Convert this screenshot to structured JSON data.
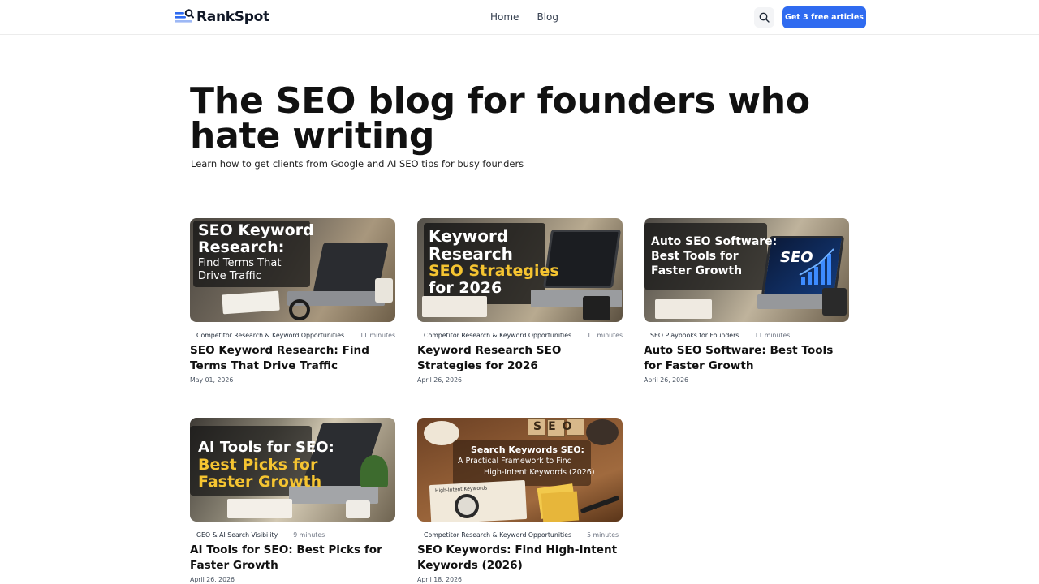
{
  "header": {
    "brand": "RankSpot",
    "nav": [
      "Home",
      "Blog"
    ],
    "cta_label": "Get 3 free articles"
  },
  "hero": {
    "title": "The SEO blog for founders who hate writing",
    "subtitle": "Learn how to get clients from Google and AI SEO tips for busy founders"
  },
  "posts": [
    {
      "category": "Competitor Research & Keyword Opportunities",
      "read_time": "11 minutes",
      "title": "SEO Keyword Research: Find Terms That Drive Traffic",
      "date": "May 01, 2026",
      "image_text": [
        "SEO Keyword",
        "Research:",
        "Find Terms That",
        "Drive Traffic"
      ]
    },
    {
      "category": "Competitor Research & Keyword Opportunities",
      "read_time": "11 minutes",
      "title": "Keyword Research SEO Strategies for 2026",
      "date": "April 26, 2026",
      "image_text": [
        "Keyword",
        "Research",
        "SEO Strategies",
        "for 2026"
      ]
    },
    {
      "category": "SEO Playbooks for Founders",
      "read_time": "11 minutes",
      "title": "Auto SEO Software: Best Tools for Faster Growth",
      "date": "April 26, 2026",
      "image_text": [
        "Auto SEO Software:",
        "Best Tools for",
        "Faster Growth",
        "SEO"
      ]
    },
    {
      "category": "GEO & AI Search Visibility",
      "read_time": "9 minutes",
      "title": "AI Tools for SEO: Best Picks for Faster Growth",
      "date": "April 26, 2026",
      "image_text": [
        "AI Tools for SEO:",
        "Best Picks for",
        "Faster Growth"
      ]
    },
    {
      "category": "Competitor Research & Keyword Opportunities",
      "read_time": "5 minutes",
      "title": "SEO Keywords: Find High-Intent Keywords (2026)",
      "date": "April 18, 2026",
      "image_text": [
        "Search Keywords SEO:",
        "A Practical Framework to Find",
        "High-Intent Keywords (2026)",
        "SEO",
        "High-Intent Keywords"
      ]
    }
  ],
  "colors": {
    "accent": "#2f6bf0",
    "highlight_yellow": "#f5c431",
    "text": "#111111"
  },
  "icons": {
    "logo": "logo-mark-icon",
    "search": "search-icon"
  }
}
